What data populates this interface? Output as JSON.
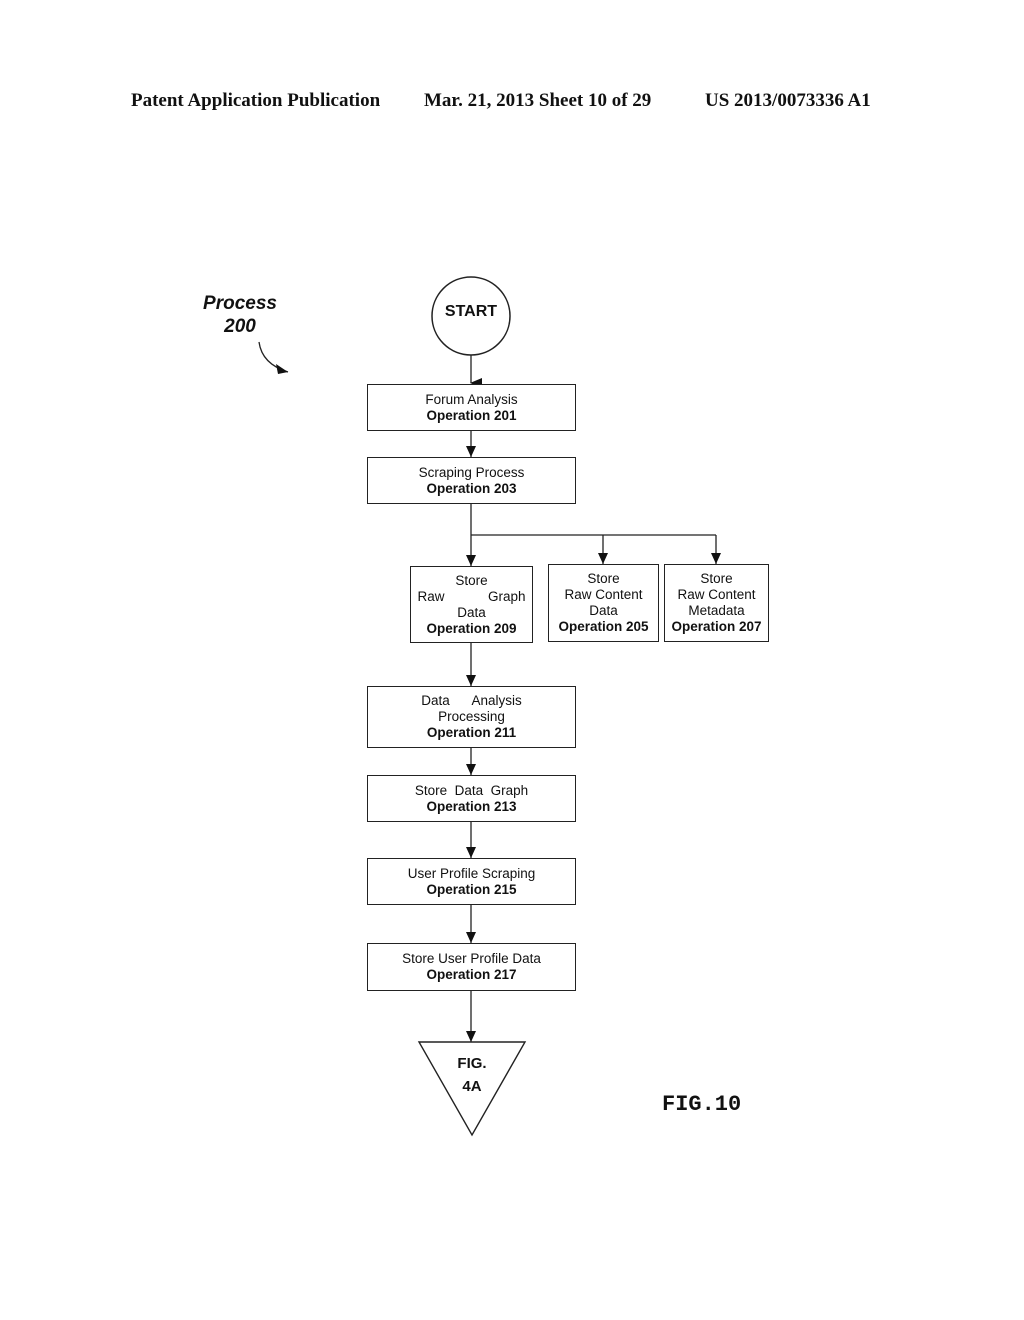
{
  "header": {
    "publication": "Patent Application Publication",
    "date_sheet": "Mar. 21, 2013  Sheet 10 of 29",
    "patent_number": "US 2013/0073336 A1"
  },
  "process_label": {
    "line1": "Process",
    "line2": "200"
  },
  "start": "START",
  "nodes": {
    "op201": {
      "title": "Forum Analysis",
      "op": "Operation 201"
    },
    "op203": {
      "title": "Scraping Process",
      "op": "Operation 203"
    },
    "op209": {
      "line1": "Store",
      "line2a": "Raw",
      "line2b": "Graph",
      "line3": "Data",
      "op": "Operation 209"
    },
    "op205": {
      "line1": "Store",
      "line2": "Raw Content",
      "line3": "Data",
      "op": "Operation 205"
    },
    "op207": {
      "line1": "Store",
      "line2": "Raw Content",
      "line3": "Metadata",
      "op": "Operation 207"
    },
    "op211": {
      "line1": "Data      Analysis",
      "line2": "Processing",
      "op": "Operation 211"
    },
    "op213": {
      "title": "Store  Data  Graph",
      "op": "Operation 213"
    },
    "op215": {
      "title": "User Profile Scraping",
      "op": "Operation 215"
    },
    "op217": {
      "title": "Store User Profile Data",
      "op": "Operation 217"
    }
  },
  "connector": {
    "line1": "FIG.",
    "line2": "4A"
  },
  "figure_label": "FIG.10"
}
